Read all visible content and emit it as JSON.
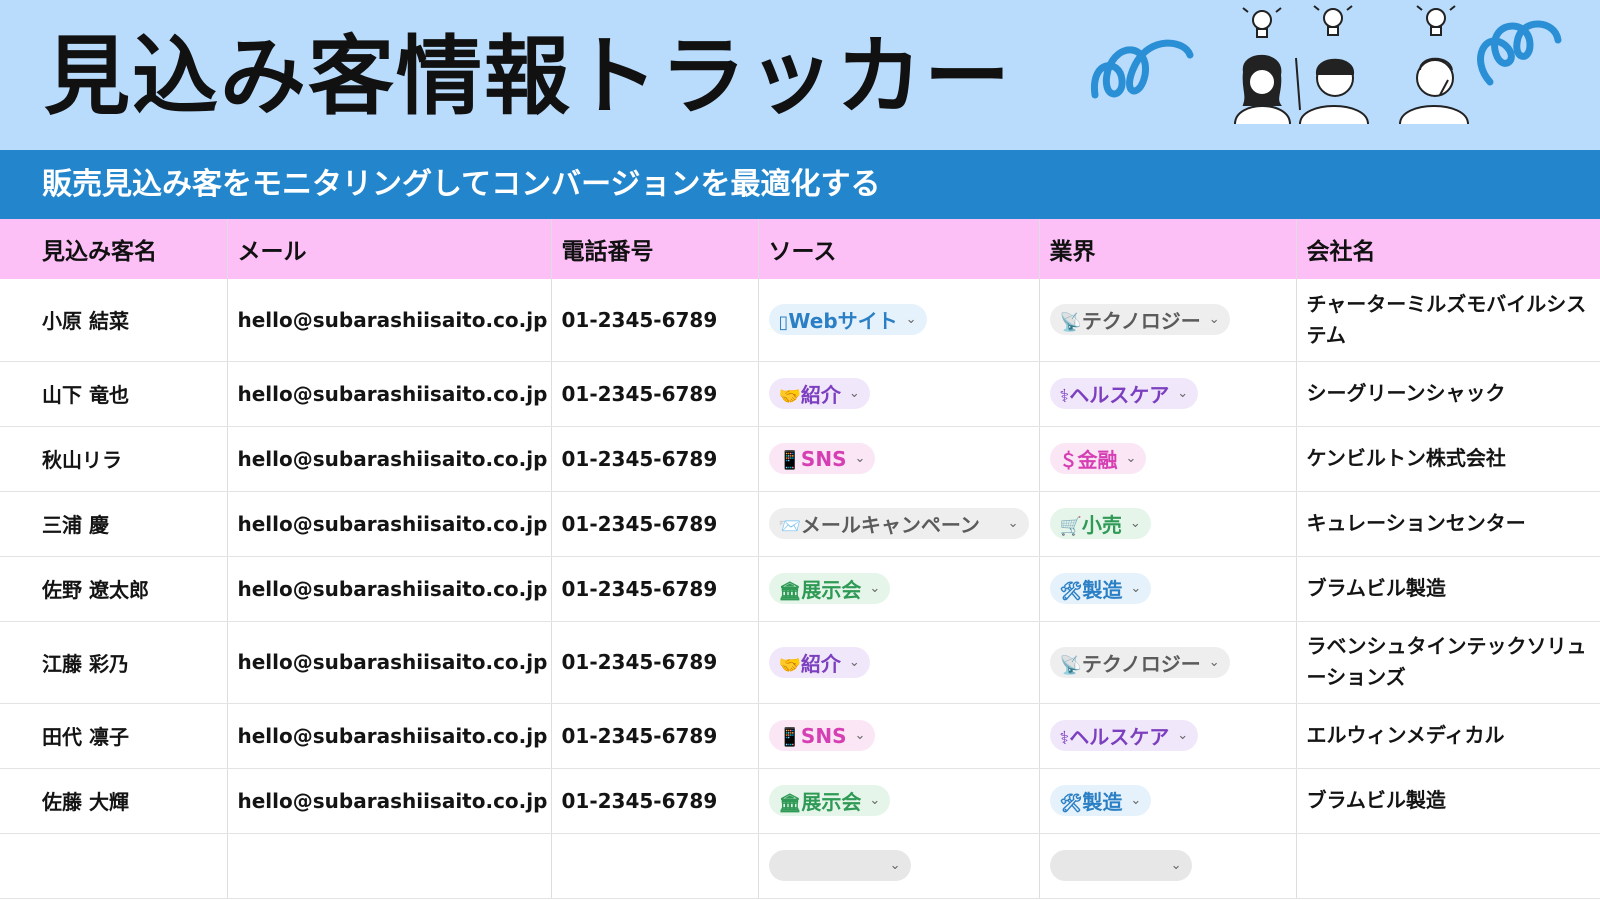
{
  "header": {
    "title": "見込み客情報トラッカー",
    "subtitle": "販売見込み客をモニタリングしてコンバージョンを最適化する"
  },
  "colors": {
    "header_bg": "#b9dcfd",
    "subtitle_bg": "#2386cc",
    "table_header_bg": "#fcc0f7",
    "deco_swirl": "#2b8fd6"
  },
  "columns": [
    "見込み客名",
    "メール",
    "電話番号",
    "ソース",
    "業界",
    "会社名"
  ],
  "rows": [
    {
      "name": "小原 結菜",
      "email": "hello@subarashiisaito.co.jp",
      "phone": "01-2345-6789",
      "source": {
        "icon": "▯",
        "label": "Webサイト",
        "color": "#2b7fc5",
        "bg": "#e6f2fb"
      },
      "industry": {
        "icon": "📡",
        "label": "テクノロジー",
        "color": "#5b5b5b",
        "bg": "#eeeeee"
      },
      "company": "チャーターミルズモバイルシステム"
    },
    {
      "name": "山下 竜也",
      "email": "hello@subarashiisaito.co.jp",
      "phone": "01-2345-6789",
      "source": {
        "icon": "🤝",
        "label": "紹介",
        "color": "#7b3fbf",
        "bg": "#f1e7fb"
      },
      "industry": {
        "icon": "⚕",
        "label": "ヘルスケア",
        "color": "#7b3fbf",
        "bg": "#f1e7fb"
      },
      "company": "シーグリーンシャック"
    },
    {
      "name": "秋山リラ",
      "email": "hello@subarashiisaito.co.jp",
      "phone": "01-2345-6789",
      "source": {
        "icon": "📱",
        "label": "SNS",
        "color": "#d63fb3",
        "bg": "#fbe6f5"
      },
      "industry": {
        "icon": "＄",
        "label": "金融",
        "color": "#d63fb3",
        "bg": "#fbe6f5"
      },
      "company": "ケンビルトン株式会社"
    },
    {
      "name": "三浦 慶",
      "email": "hello@subarashiisaito.co.jp",
      "phone": "01-2345-6789",
      "source": {
        "icon": "📨",
        "label": "メールキャンペーン",
        "color": "#5b5b5b",
        "bg": "#eeeeee"
      },
      "industry": {
        "icon": "🛒",
        "label": "小売",
        "color": "#2e9a55",
        "bg": "#e5f5ea"
      },
      "company": "キュレーションセンター"
    },
    {
      "name": "佐野 遼太郎",
      "email": "hello@subarashiisaito.co.jp",
      "phone": "01-2345-6789",
      "source": {
        "icon": "🏛",
        "label": "展示会",
        "color": "#2e9a55",
        "bg": "#e5f5ea"
      },
      "industry": {
        "icon": "🛠",
        "label": "製造",
        "color": "#2b7fc5",
        "bg": "#e6f2fb"
      },
      "company": "ブラムビル製造"
    },
    {
      "name": "江藤 彩乃",
      "email": "hello@subarashiisaito.co.jp",
      "phone": "01-2345-6789",
      "source": {
        "icon": "🤝",
        "label": "紹介",
        "color": "#7b3fbf",
        "bg": "#f1e7fb"
      },
      "industry": {
        "icon": "📡",
        "label": "テクノロジー",
        "color": "#5b5b5b",
        "bg": "#eeeeee"
      },
      "company": "ラベンシュタインテックソリューションズ"
    },
    {
      "name": "田代 凛子",
      "email": "hello@subarashiisaito.co.jp",
      "phone": "01-2345-6789",
      "source": {
        "icon": "📱",
        "label": "SNS",
        "color": "#d63fb3",
        "bg": "#fbe6f5"
      },
      "industry": {
        "icon": "⚕",
        "label": "ヘルスケア",
        "color": "#7b3fbf",
        "bg": "#f1e7fb"
      },
      "company": "エルウィンメディカル"
    },
    {
      "name": "佐藤 大輝",
      "email": "hello@subarashiisaito.co.jp",
      "phone": "01-2345-6789",
      "source": {
        "icon": "🏛",
        "label": "展示会",
        "color": "#2e9a55",
        "bg": "#e5f5ea"
      },
      "industry": {
        "icon": "🛠",
        "label": "製造",
        "color": "#2b7fc5",
        "bg": "#e6f2fb"
      },
      "company": "ブラムビル製造"
    }
  ],
  "icons": {
    "dropdown": "chevron-down-icon",
    "decoration": [
      "swirl-left-icon",
      "lightbulb-icon",
      "people-thinking-illustration",
      "swirl-right-icon"
    ]
  }
}
